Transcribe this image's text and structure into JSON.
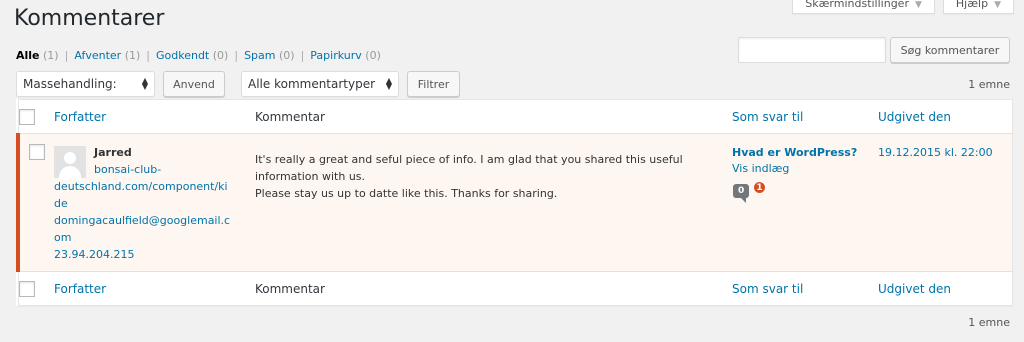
{
  "screen_meta": {
    "options_label": "Skærmindstillinger",
    "help_label": "Hjælp"
  },
  "page_title": "Kommentarer",
  "views": [
    {
      "label": "Alle",
      "count": "(1)"
    },
    {
      "label": "Afventer",
      "count": "(1)"
    },
    {
      "label": "Godkendt",
      "count": "(0)"
    },
    {
      "label": "Spam",
      "count": "(0)"
    },
    {
      "label": "Papirkurv",
      "count": "(0)"
    }
  ],
  "search": {
    "value": "",
    "button": "Søg kommentarer"
  },
  "tablenav": {
    "bulk_action": "Massehandling:",
    "apply": "Anvend",
    "comment_type": "Alle kommentartyper",
    "filter": "Filtrer",
    "item_count": "1 emne"
  },
  "columns": {
    "author": "Forfatter",
    "comment": "Kommentar",
    "response": "Som svar til",
    "date": "Udgivet den"
  },
  "comment": {
    "author_name": "Jarred",
    "author_url_lines": [
      "bonsai-club-",
      "deutschland.com/component/ki",
      "de"
    ],
    "author_email_lines": [
      "domingacaulfield@googlemail.c",
      "om"
    ],
    "author_ip": "23.94.204.215",
    "text_line1": "It's really a great and seful piece of info. I am glad that you shared this useful",
    "text_line2": "information with us.",
    "text_line3": "Please stay us up to datte like this. Thanks for sharing.",
    "post_title": "Hvad er WordPress?",
    "view_post": "Vis indlæg",
    "approved_count": "0",
    "pending_count": "1",
    "date": "19.12.2015 kl. 22:00"
  }
}
